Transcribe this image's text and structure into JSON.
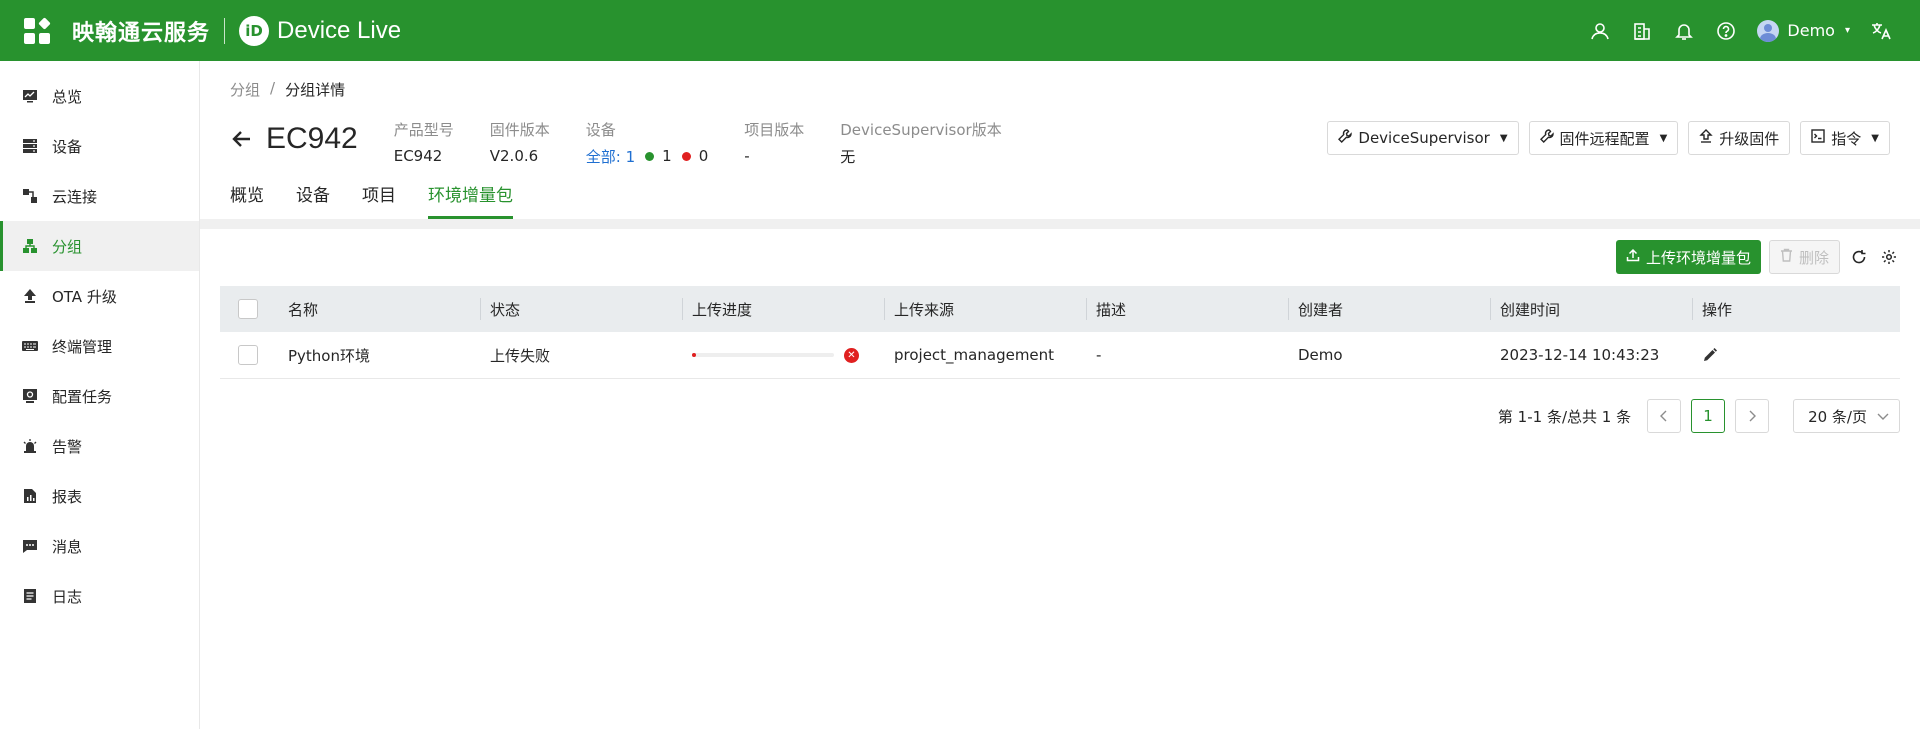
{
  "topbar": {
    "brand": "映翰通云服务",
    "product_logo_text": "iD",
    "product_name": "Device Live",
    "user_name": "Demo",
    "icons": [
      "user-icon",
      "building-icon",
      "bell-icon",
      "help-icon",
      "translate-icon"
    ]
  },
  "sidebar": {
    "items": [
      {
        "label": "总览",
        "icon": "dashboard-icon"
      },
      {
        "label": "设备",
        "icon": "device-icon"
      },
      {
        "label": "云连接",
        "icon": "cloud-connect-icon"
      },
      {
        "label": "分组",
        "icon": "group-icon"
      },
      {
        "label": "OTA 升级",
        "icon": "upload-icon"
      },
      {
        "label": "终端管理",
        "icon": "keyboard-icon"
      },
      {
        "label": "配置任务",
        "icon": "config-task-icon"
      },
      {
        "label": "告警",
        "icon": "alarm-icon"
      },
      {
        "label": "报表",
        "icon": "report-icon"
      },
      {
        "label": "消息",
        "icon": "message-icon"
      },
      {
        "label": "日志",
        "icon": "log-icon"
      }
    ],
    "active_index": 3
  },
  "breadcrumb": {
    "parent": "分组",
    "separator": "/",
    "current": "分组详情"
  },
  "header": {
    "title": "EC942",
    "meta": {
      "model_label": "产品型号",
      "model_value": "EC942",
      "firmware_label": "固件版本",
      "firmware_value": "V2.0.6",
      "device_label": "设备",
      "device_all": "全部: 1",
      "device_online": "1",
      "device_offline": "0",
      "project_version_label": "项目版本",
      "project_version_value": "-",
      "ds_version_label": "DeviceSupervisor版本",
      "ds_version_value": "无"
    },
    "actions": {
      "device_supervisor": "DeviceSupervisor",
      "firmware_remote_config": "固件远程配置",
      "upgrade_firmware": "升级固件",
      "command": "指令"
    }
  },
  "tabs": [
    "概览",
    "设备",
    "项目",
    "环境增量包"
  ],
  "active_tab": 3,
  "toolbar": {
    "upload_label": "上传环境增量包",
    "delete_label": "删除"
  },
  "table": {
    "columns": [
      "名称",
      "状态",
      "上传进度",
      "上传来源",
      "描述",
      "创建者",
      "创建时间",
      "操作"
    ],
    "rows": [
      {
        "name": "Python环境",
        "status": "上传失败",
        "progress": 0.02,
        "source": "project_management",
        "description": "-",
        "creator": "Demo",
        "created_at": "2023-12-14 10:43:23"
      }
    ]
  },
  "pagination": {
    "info": "第 1-1 条/总共 1 条",
    "current_page": "1",
    "page_size": "20 条/页"
  },
  "colors": {
    "brand_green": "#28922e",
    "error_red": "#e02020",
    "link_blue": "#1f6fd1"
  }
}
